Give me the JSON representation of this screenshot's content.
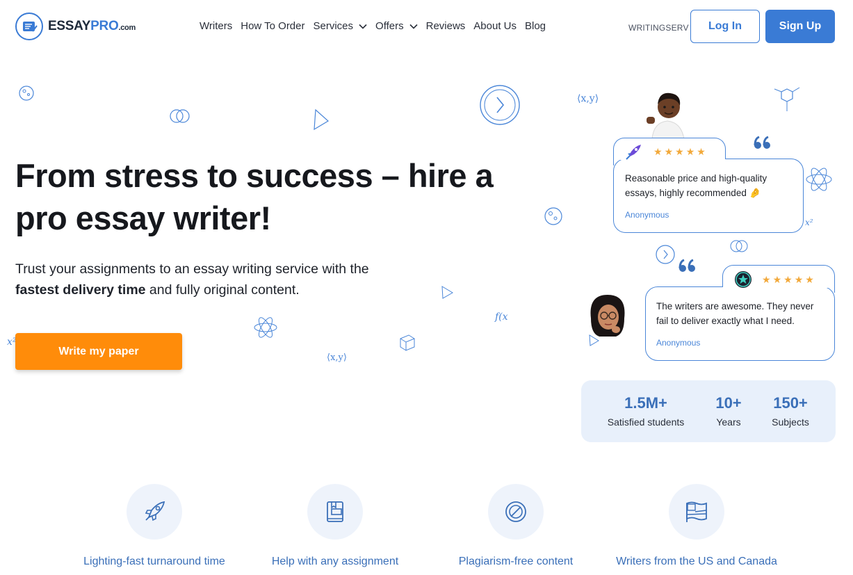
{
  "header": {
    "logo": {
      "essay": "ESSAY",
      "pro": "PRO",
      "com": ".com"
    },
    "nav": [
      {
        "label": "Writers",
        "has_dropdown": false
      },
      {
        "label": "How To Order",
        "has_dropdown": false
      },
      {
        "label": "Services",
        "has_dropdown": true
      },
      {
        "label": "Offers",
        "has_dropdown": true
      },
      {
        "label": "Reviews",
        "has_dropdown": false
      },
      {
        "label": "About Us",
        "has_dropdown": false
      },
      {
        "label": "Blog",
        "has_dropdown": false
      }
    ],
    "promo_label": "WRITINGSERV",
    "login_label": "Log In",
    "signup_label": "Sign Up"
  },
  "hero": {
    "title": "From stress to success – hire a pro essay writer!",
    "subtitle_pre": "Trust your assignments to an essay writing service with the ",
    "subtitle_bold": "fastest delivery time",
    "subtitle_post": " and fully original content.",
    "cta_label": "Write my paper"
  },
  "reviews": [
    {
      "text": "Reasonable price and high-quality essays, highly recommended 🤌",
      "author": "Anonymous",
      "rating": 5,
      "badge_icon": "rocket-icon"
    },
    {
      "text": "The writers are awesome. They never fail to deliver exactly what I need.",
      "author": "Anonymous",
      "rating": 5,
      "badge_icon": "star-badge-icon"
    }
  ],
  "stats": [
    {
      "value": "1.5M+",
      "label": "Satisfied students"
    },
    {
      "value": "10+",
      "label": "Years"
    },
    {
      "value": "150+",
      "label": "Subjects"
    }
  ],
  "features": [
    {
      "label": "Lighting-fast turnaround time",
      "icon": "rocket-icon"
    },
    {
      "label": "Help with any assignment",
      "icon": "book-icon"
    },
    {
      "label": "Plagiarism-free content",
      "icon": "no-plagiarism-icon"
    },
    {
      "label": "Writers from the US and Canada",
      "icon": "flag-icon"
    }
  ],
  "colors": {
    "brand_blue": "#3a7bd5",
    "cta_orange": "#ff8c0a",
    "star": "#f2a93b",
    "stats_bg": "#e8f0fb"
  }
}
